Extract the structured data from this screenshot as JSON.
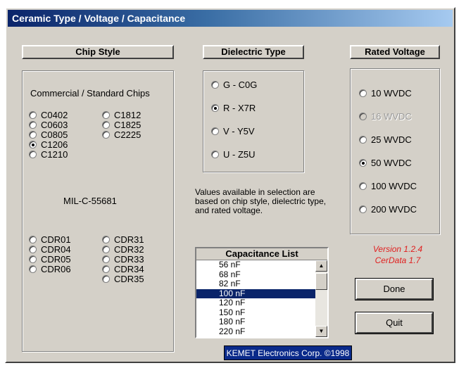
{
  "window": {
    "title": "Ceramic Type / Voltage / Capacitance"
  },
  "chip_style": {
    "header": "Chip Style",
    "commercial_label": "Commercial / Standard Chips",
    "commercial_col1": [
      {
        "label": "C0402",
        "checked": false
      },
      {
        "label": "C0603",
        "checked": false
      },
      {
        "label": "C0805",
        "checked": false
      },
      {
        "label": "C1206",
        "checked": true
      },
      {
        "label": "C1210",
        "checked": false
      }
    ],
    "commercial_col2": [
      {
        "label": "C1812",
        "checked": false
      },
      {
        "label": "C1825",
        "checked": false
      },
      {
        "label": "C2225",
        "checked": false
      }
    ],
    "mil_label": "MIL-C-55681",
    "mil_col1": [
      {
        "label": "CDR01",
        "checked": false
      },
      {
        "label": "CDR04",
        "checked": false
      },
      {
        "label": "CDR05",
        "checked": false
      },
      {
        "label": "CDR06",
        "checked": false
      }
    ],
    "mil_col2": [
      {
        "label": "CDR31",
        "checked": false
      },
      {
        "label": "CDR32",
        "checked": false
      },
      {
        "label": "CDR33",
        "checked": false
      },
      {
        "label": "CDR34",
        "checked": false
      },
      {
        "label": "CDR35",
        "checked": false
      }
    ]
  },
  "dielectric": {
    "header": "Dielectric Type",
    "options": [
      {
        "label": "G - C0G",
        "checked": false
      },
      {
        "label": "R - X7R",
        "checked": true
      },
      {
        "label": "V - Y5V",
        "checked": false
      },
      {
        "label": "U - Z5U",
        "checked": false
      }
    ],
    "note": "Values available in selection are based on chip style, dielectric type, and rated voltage."
  },
  "voltage": {
    "header": "Rated Voltage",
    "options": [
      {
        "label": "10 WVDC",
        "checked": false,
        "disabled": false
      },
      {
        "label": "16 WVDC",
        "checked": false,
        "disabled": true
      },
      {
        "label": "25 WVDC",
        "checked": false,
        "disabled": false
      },
      {
        "label": "50 WVDC",
        "checked": true,
        "disabled": false
      },
      {
        "label": "100 WVDC",
        "checked": false,
        "disabled": false
      },
      {
        "label": "200 WVDC",
        "checked": false,
        "disabled": false
      }
    ]
  },
  "capacitance": {
    "header": "Capacitance List",
    "items": [
      "56 nF",
      "68 nF",
      "82 nF",
      "100 nF",
      "120 nF",
      "150 nF",
      "180 nF",
      "220 nF"
    ],
    "selected": "100 nF"
  },
  "version": {
    "line1": "Version 1.2.4",
    "line2": "CerData 1.7"
  },
  "buttons": {
    "done": "Done",
    "quit": "Quit"
  },
  "footer": "KEMET Electronics Corp. ©1998"
}
